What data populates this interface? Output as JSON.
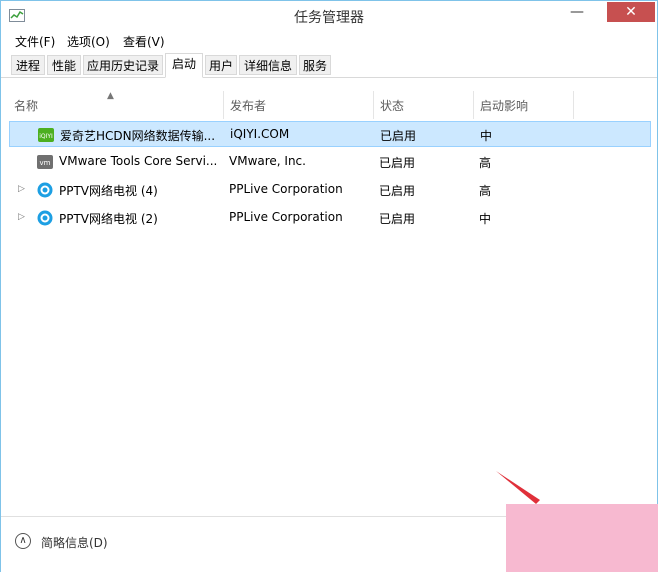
{
  "window": {
    "title": "任务管理器"
  },
  "menu": [
    {
      "label": "文件(F)"
    },
    {
      "label": "选项(O)"
    },
    {
      "label": "查看(V)"
    }
  ],
  "tabs": [
    {
      "label": "进程"
    },
    {
      "label": "性能"
    },
    {
      "label": "应用历史记录"
    },
    {
      "label": "启动",
      "active": true
    },
    {
      "label": "用户"
    },
    {
      "label": "详细信息"
    },
    {
      "label": "服务"
    }
  ],
  "columns": [
    {
      "label": "名称"
    },
    {
      "label": "发布者"
    },
    {
      "label": "状态"
    },
    {
      "label": "启动影响"
    }
  ],
  "rows": [
    {
      "name": "爱奇艺HCDN网络数据传输...",
      "publisher": "iQIYI.COM",
      "status": "已启用",
      "impact": "中",
      "icon": "iqiyi-icon",
      "expandable": false,
      "selected": true
    },
    {
      "name": "VMware Tools Core Servi...",
      "publisher": "VMware, Inc.",
      "status": "已启用",
      "impact": "高",
      "icon": "vmware-icon",
      "expandable": false,
      "selected": false
    },
    {
      "name": "PPTV网络电视 (4)",
      "publisher": "PPLive Corporation",
      "status": "已启用",
      "impact": "高",
      "icon": "pptv-icon",
      "expandable": true,
      "selected": false
    },
    {
      "name": "PPTV网络电视 (2)",
      "publisher": "PPLive Corporation",
      "status": "已启用",
      "impact": "中",
      "icon": "pptv-icon",
      "expandable": true,
      "selected": false
    }
  ],
  "footer": {
    "fewer_details": "简略信息(D)"
  },
  "icons": {
    "iqiyi_label": "iQIYI",
    "vmware_label": "vm"
  },
  "colors": {
    "selection": "#cce8ff",
    "annotation_arrow": "#e0303a",
    "annotation_box": "#f7b9d0"
  }
}
